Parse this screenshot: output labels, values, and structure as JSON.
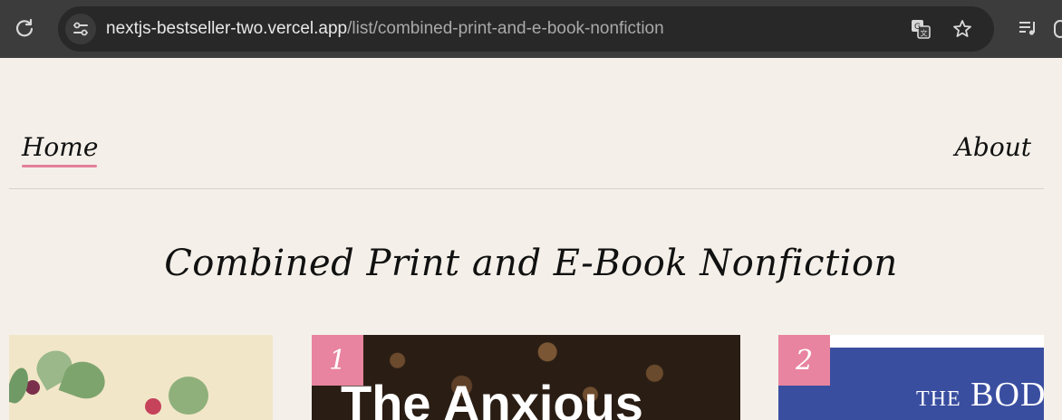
{
  "browser": {
    "url_host": "nextjs-bestseller-two.vercel.app",
    "url_path": "/list/combined-print-and-e-book-nonfiction",
    "icons": [
      "reload-icon",
      "site-info-icon",
      "translate-icon",
      "star-icon",
      "media-queue-icon"
    ]
  },
  "nav": {
    "home_label": "Home",
    "about_label": "About",
    "accent_color": "#e47f9c"
  },
  "page": {
    "title": "Combined Print and E-Book Nonfiction"
  },
  "books": [
    {
      "rank": ""
    },
    {
      "rank": "1",
      "cover_text": "The Anxious"
    },
    {
      "rank": "2",
      "cover_text_small": "THE",
      "cover_text": "BOD"
    }
  ],
  "colors": {
    "background": "#f4f0e9",
    "rank_badge": "#e8849f"
  }
}
